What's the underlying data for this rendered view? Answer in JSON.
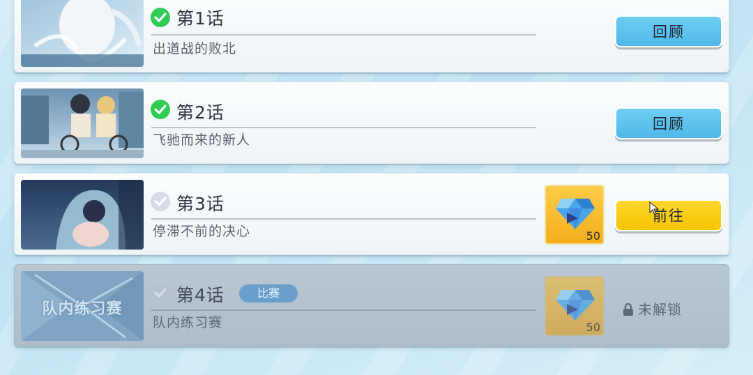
{
  "episodes": [
    {
      "title": "第1话",
      "subtitle": "出道战的败北",
      "status": "completed",
      "button": "回顾"
    },
    {
      "title": "第2话",
      "subtitle": "飞驰而来的新人",
      "status": "completed",
      "button": "回顾"
    },
    {
      "title": "第3话",
      "subtitle": "停滞不前的决心",
      "status": "available",
      "button": "前往",
      "reward_qty": "50"
    },
    {
      "title": "第4话",
      "subtitle": "队内练习赛",
      "status": "locked",
      "tag": "比赛",
      "reward_qty": "50",
      "lock_label": "未解锁",
      "thumb_text": "队内练习赛"
    }
  ],
  "colors": {
    "done_check": "#2ecc52",
    "button_blue": "#5cc3ee",
    "button_yellow": "#f8cb0c",
    "locked_card": "#b4c3d0"
  },
  "icons": [
    "check-icon",
    "gem-icon",
    "lock-icon",
    "cursor-icon"
  ]
}
